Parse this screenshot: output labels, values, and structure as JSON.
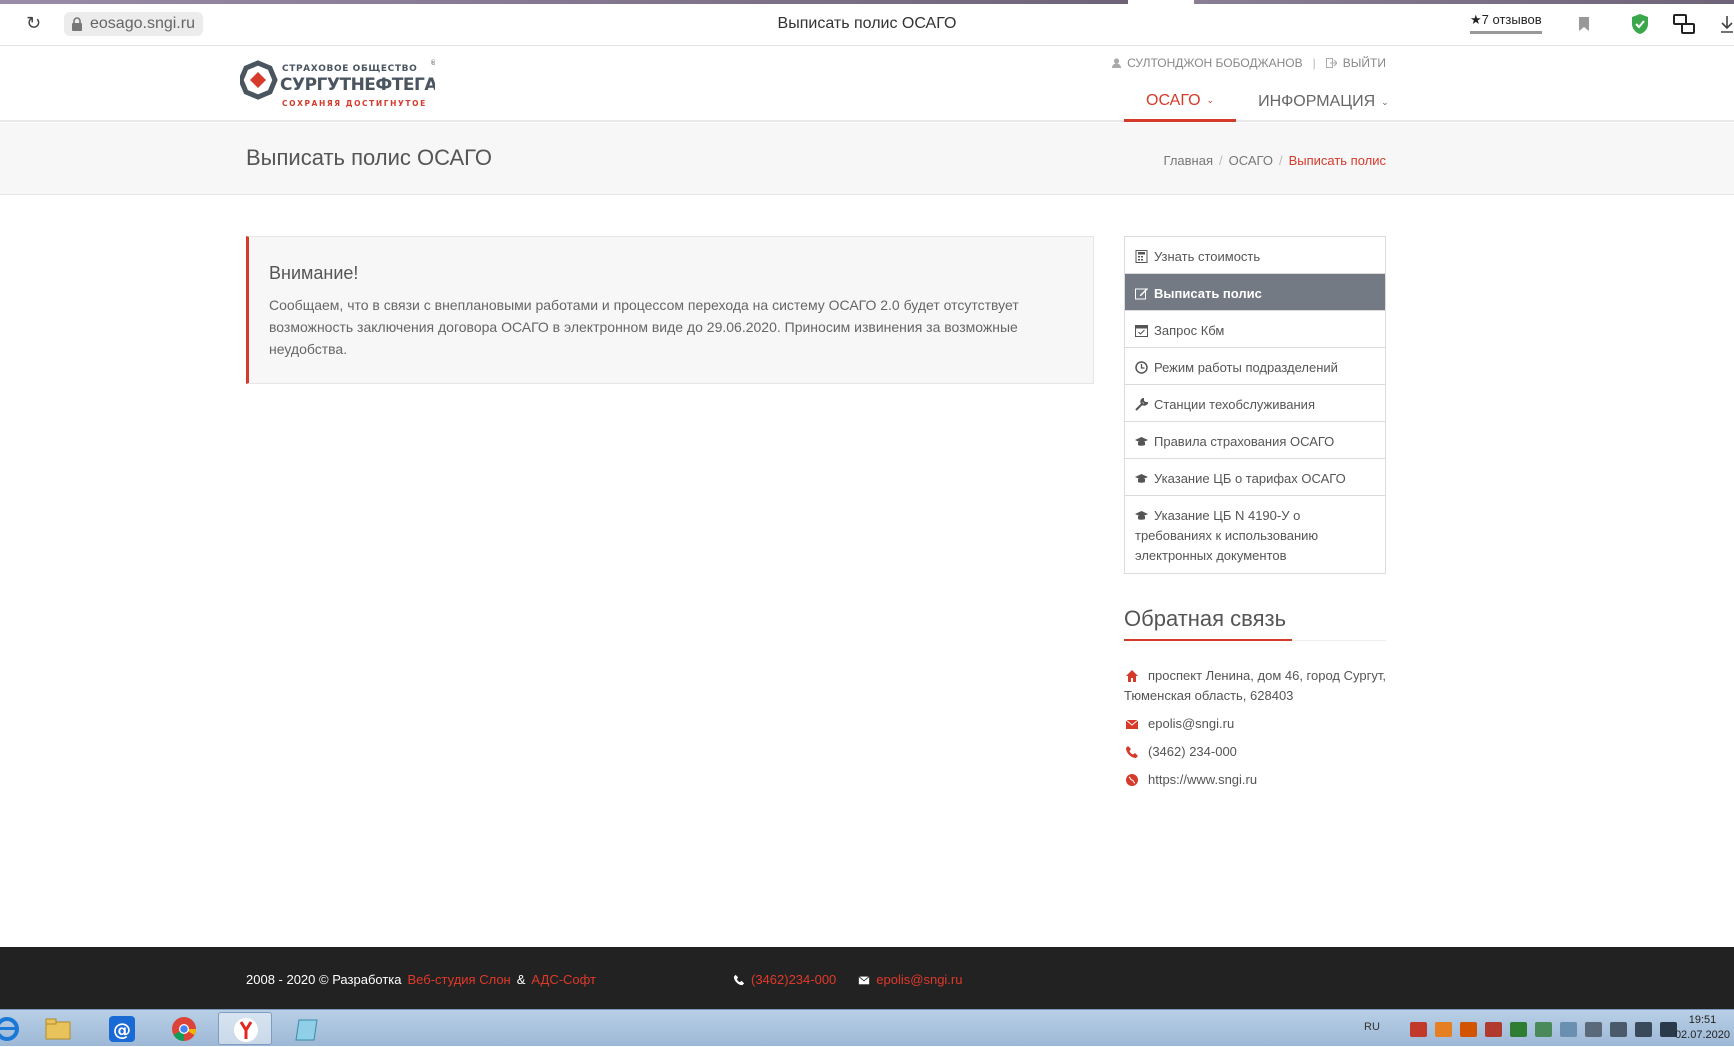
{
  "browser": {
    "url": "eosago.sngi.ru",
    "tab_title": "Выписать полис ОСАГО",
    "reviews_label": "★7 отзывов"
  },
  "header": {
    "logo_alt": "Страховое общество Сургутнефтегаз — Сохраняя достигнутое",
    "user_name": "СУЛТОНДЖОН БОБОДЖАНОВ",
    "separator": "|",
    "logout_label": "ВЫЙТИ",
    "nav": [
      {
        "label": "ОСАГО",
        "active": true
      },
      {
        "label": "ИНФОРМАЦИЯ",
        "active": false
      }
    ]
  },
  "page": {
    "title": "Выписать полис ОСАГО",
    "breadcrumb": [
      "Главная",
      "ОСАГО",
      "Выписать полис"
    ]
  },
  "alert": {
    "title": "Внимание!",
    "text_lines": [
      "Сообщаем, что в связи с внеплановыми работами и процессом перехода на систему ОСАГО 2.0 будет отсутствует",
      "возможность заключения договора ОСАГО в электронном виде до 29.06.2020. Приносим извинения за возможные",
      "неудобства."
    ]
  },
  "sidebar": {
    "items": [
      {
        "label": "Узнать стоимость",
        "icon": "calculator-icon",
        "active": false
      },
      {
        "label": "Выписать полис",
        "icon": "edit-icon",
        "active": true
      },
      {
        "label": "Запрос Кбм",
        "icon": "calendar-check-icon",
        "active": false
      },
      {
        "label": "Режим работы подразделений",
        "icon": "clock-icon",
        "active": false
      },
      {
        "label": "Станции техобслуживания",
        "icon": "wrench-icon",
        "active": false
      },
      {
        "label": "Правила страхования ОСАГО",
        "icon": "graduation-cap-icon",
        "active": false
      },
      {
        "label": "Указание ЦБ о тарифах ОСАГО",
        "icon": "graduation-cap-icon",
        "active": false
      },
      {
        "label_lines": [
          "Указание ЦБ N 4190-У о",
          "требованиях к использованию",
          "электронных документов"
        ],
        "icon": "graduation-cap-icon",
        "active": false
      }
    ]
  },
  "feedback": {
    "title": "Обратная связь",
    "address_lines": [
      "проспект Ленина, дом 46, город Сургут,",
      "Тюменская область, 628403"
    ],
    "email": "epolis@sngi.ru",
    "phone": "(3462) 234-000",
    "website": "https://www.sngi.ru"
  },
  "footer": {
    "copyright": "2008 - 2020 © Разработка",
    "studio": "Веб-студия Слон",
    "amp": "&",
    "partner": "АДС-Софт",
    "phone": "(3462)234-000",
    "email": "epolis@sngi.ru"
  },
  "taskbar": {
    "lang": "RU",
    "time": "19:51",
    "date": "02.07.2020"
  },
  "colors": {
    "accent": "#d63a2b",
    "active_menu_bg": "#737a83",
    "footer_bg": "#222222"
  }
}
